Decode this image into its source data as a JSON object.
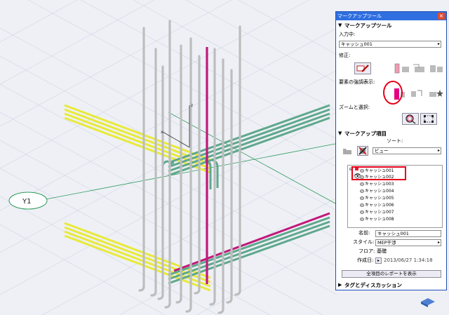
{
  "palette": {
    "title": "マークアップツール",
    "close_glyph": "×",
    "section_markup_tool": "マークアップツール",
    "input_label": "入力中:",
    "input_value": "キャッシュ001",
    "edit_label": "修正:",
    "highlight_label": "要素の強調表示:",
    "zoom_select_label": "ズームと選択:",
    "section_markup_items": "マークアップ項目",
    "sort_label": "ソート:",
    "sort_value": "ビュー",
    "tree_items": [
      "キャッシュ001",
      "キャッシュ002",
      "キャッシュ003",
      "キャッシュ004",
      "キャッシュ005",
      "キャッシュ006",
      "キャッシュ007",
      "キャッシュ008"
    ],
    "name_label": "名前:",
    "name_value": "キャッシュ001",
    "style_label": "スタイル:",
    "style_value": "MEP干渉",
    "floor_label": "フロア:",
    "floor_value": "基礎",
    "created_label": "作成日:",
    "created_value": "2013/06/27 1:34:18",
    "report_button": "全項目のレポートを表示",
    "section_tags": "タグとディスカッション",
    "highlight_color": "#e4007f",
    "accent_red": "#e6001a"
  },
  "viewport": {
    "axis_z": "z",
    "axis_x": "x",
    "grid_bubble": "Y1"
  }
}
